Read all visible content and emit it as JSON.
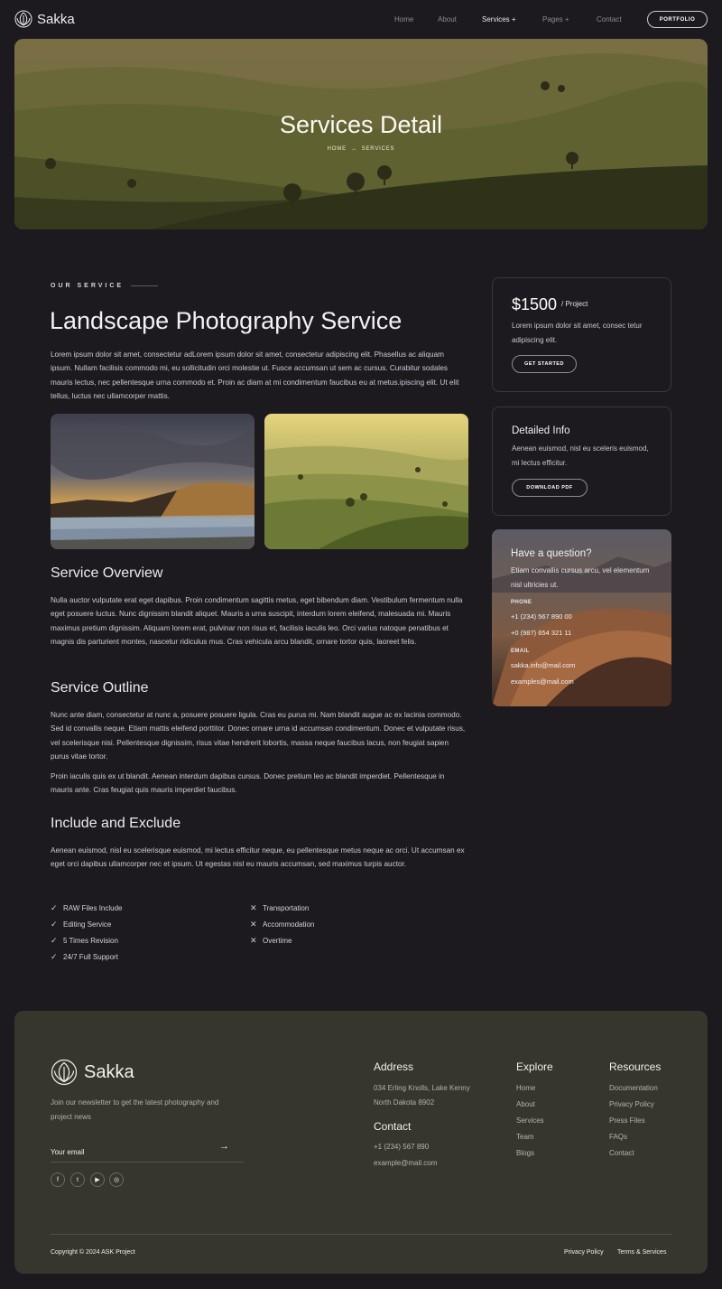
{
  "nav": {
    "brand": "Sakka",
    "links": [
      "Home",
      "About",
      "Services",
      "Pages",
      "Contact"
    ],
    "services_suffix": "+",
    "pages_suffix": "+",
    "portfolio_label": "PORTFOLIO"
  },
  "hero": {
    "title": "Services Detail",
    "crumb_home": "HOME",
    "crumb_arrow": "→",
    "crumb_current": "SERVICES"
  },
  "main": {
    "eyebrow": "OUR SERVICE",
    "title": "Landscape Photography Service",
    "intro": "Lorem ipsum dolor sit amet, consectetur adLorem ipsum dolor sit amet, consectetur adipiscing elit. Phasellus ac aliquam ipsum. Nullam facilisis commodo mi, eu sollicitudin orci molestie ut. Fusce accumsan ut sem ac cursus. Curabitur sodales mauris lectus, nec pellentesque urna commodo et. Proin ac diam at mi condimentum faucibus eu at metus.ipiscing elit. Ut elit tellus, luctus nec ullamcorper mattis.",
    "overview_heading": "Service Overview",
    "overview_text": "Nulla auctor vulputate erat eget dapibus. Proin condimentum sagittis metus, eget bibendum diam. Vestibulum fermentum nulla eget posuere luctus. Nunc dignissim blandit aliquet. Mauris a urna suscipit, interdum lorem eleifend, malesuada mi. Mauris maximus pretium dignissim. Aliquam lorem erat, pulvinar non risus et, facilisis iaculis leo. Orci varius natoque penatibus et magnis dis parturient montes, nascetur ridiculus mus. Cras vehicula arcu blandit, ornare tortor quis, laoreet felis.",
    "outline_heading": "Service Outline",
    "outline_text_1": "Nunc ante diam, consectetur at nunc a, posuere posuere ligula. Cras eu purus mi. Nam blandit augue ac ex lacinia commodo. Sed id convallis neque. Etiam mattis eleifend porttitor. Donec ornare urna id accumsan condimentum. Donec et vulputate risus, vel scelerisque nisi. Pellentesque dignissim, risus vitae hendrerit lobortis, massa neque faucibus lacus, non feugiat sapien purus vitae tortor.",
    "outline_text_2": "Proin iaculis quis ex ut blandit. Aenean interdum dapibus cursus. Donec pretium leo ac blandit imperdiet. Pellentesque in mauris ante. Cras feugiat quis mauris imperdiet faucibus.",
    "include_heading": "Include and Exclude",
    "include_text": "Aenean euismod, nisl eu scelerisque euismod, mi lectus efficitur neque, eu pellentesque metus neque ac orci. Ut accumsan ex eget orci dapibus ullamcorper nec et ipsum. Ut egestas nisl eu mauris accumsan, sed maximus turpis auctor.",
    "included": [
      "RAW Files Include",
      "Editing Service",
      "5 Times Revision",
      "24/7 Full Support"
    ],
    "excluded": [
      "Transportation",
      "Accommodation",
      "Overtime"
    ]
  },
  "sidebar": {
    "price": "$1500",
    "price_unit": "/ Project",
    "price_text": "Lorem ipsum dolor sit amet, consec tetur adipiscing elit.",
    "get_started": "GET STARTED",
    "info_heading": "Detailed Info",
    "info_text": "Aenean euismod, nisl eu sceleris euismod, mi lectus efficitur.",
    "download_pdf": "DOWNLOAD PDF",
    "question_heading": "Have a question?",
    "question_text": "Etiam convallis cursus arcu, vel elementum nisl ultricies ut.",
    "phone_label": "PHONE",
    "phone_1": "+1 (234) 567 890 00",
    "phone_2": "+0 (987) 654 321 11",
    "email_label": "EMAIL",
    "email_1": "sakka.info@mail.com",
    "email_2": "examples@mail.com"
  },
  "footer": {
    "brand": "Sakka",
    "newsletter_text": "Join our newsletter to get the latest photography and project news",
    "email_placeholder": "Your email",
    "address_heading": "Address",
    "address_text": "034 Erling Knolls, Lake Kenny North Dakota 8902",
    "contact_heading": "Contact",
    "contact_phone": "+1 (234) 567 890",
    "contact_email": "example@mail.com",
    "explore_heading": "Explore",
    "explore_links": [
      "Home",
      "About",
      "Services",
      "Team",
      "Blogs"
    ],
    "resources_heading": "Resources",
    "resources_links": [
      "Documentation",
      "Privacy Policy",
      "Press Files",
      "FAQs",
      "Contact"
    ],
    "copyright": "Copyright © 2024 ASK Project",
    "privacy": "Privacy Policy",
    "terms": "Terms & Services"
  }
}
